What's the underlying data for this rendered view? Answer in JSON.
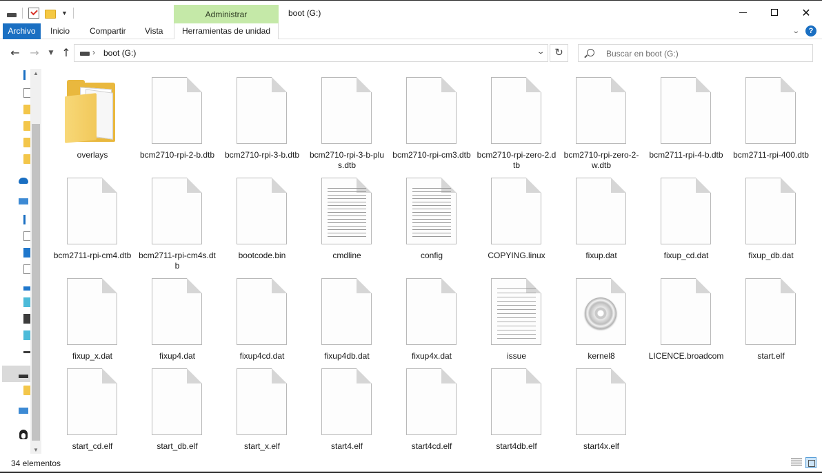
{
  "window": {
    "title": "boot (G:)",
    "context_tab": "Administrar",
    "minimize_label": "",
    "maximize_label": "",
    "close_label": "✕"
  },
  "ribbon": {
    "tabs": [
      "Archivo",
      "Inicio",
      "Compartir",
      "Vista",
      "Herramientas de unidad"
    ],
    "help_label": "?"
  },
  "address": {
    "path": "boot (G:)",
    "separator": "›",
    "refresh": "↻"
  },
  "search": {
    "placeholder": "Buscar en boot (G:)"
  },
  "nav": {
    "back": "←",
    "forward": "→",
    "recent": "⌄",
    "up": "↑"
  },
  "files": [
    {
      "name": "overlays",
      "icon": "folder"
    },
    {
      "name": "bcm2710-rpi-2-b.dtb",
      "icon": "blank"
    },
    {
      "name": "bcm2710-rpi-3-b.dtb",
      "icon": "blank"
    },
    {
      "name": "bcm2710-rpi-3-b-plus.dtb",
      "icon": "blank"
    },
    {
      "name": "bcm2710-rpi-cm3.dtb",
      "icon": "blank"
    },
    {
      "name": "bcm2710-rpi-zero-2.dtb",
      "icon": "blank"
    },
    {
      "name": "bcm2710-rpi-zero-2-w.dtb",
      "icon": "blank"
    },
    {
      "name": "bcm2711-rpi-4-b.dtb",
      "icon": "blank"
    },
    {
      "name": "bcm2711-rpi-400.dtb",
      "icon": "blank"
    },
    {
      "name": "bcm2711-rpi-cm4.dtb",
      "icon": "blank"
    },
    {
      "name": "bcm2711-rpi-cm4s.dtb",
      "icon": "blank"
    },
    {
      "name": "bootcode.bin",
      "icon": "blank"
    },
    {
      "name": "cmdline",
      "icon": "text"
    },
    {
      "name": "config",
      "icon": "text"
    },
    {
      "name": "COPYING.linux",
      "icon": "blank"
    },
    {
      "name": "fixup.dat",
      "icon": "blank"
    },
    {
      "name": "fixup_cd.dat",
      "icon": "blank"
    },
    {
      "name": "fixup_db.dat",
      "icon": "blank"
    },
    {
      "name": "fixup_x.dat",
      "icon": "blank"
    },
    {
      "name": "fixup4.dat",
      "icon": "blank"
    },
    {
      "name": "fixup4cd.dat",
      "icon": "blank"
    },
    {
      "name": "fixup4db.dat",
      "icon": "blank"
    },
    {
      "name": "fixup4x.dat",
      "icon": "blank"
    },
    {
      "name": "issue",
      "icon": "text"
    },
    {
      "name": "kernel8",
      "icon": "disc"
    },
    {
      "name": "LICENCE.broadcom",
      "icon": "blank"
    },
    {
      "name": "start.elf",
      "icon": "blank"
    },
    {
      "name": "start_cd.elf",
      "icon": "blank"
    },
    {
      "name": "start_db.elf",
      "icon": "blank"
    },
    {
      "name": "start_x.elf",
      "icon": "blank"
    },
    {
      "name": "start4.elf",
      "icon": "blank"
    },
    {
      "name": "start4cd.elf",
      "icon": "blank"
    },
    {
      "name": "start4db.elf",
      "icon": "blank"
    },
    {
      "name": "start4x.elf",
      "icon": "blank"
    }
  ],
  "status": {
    "item_count": "34 elementos"
  }
}
